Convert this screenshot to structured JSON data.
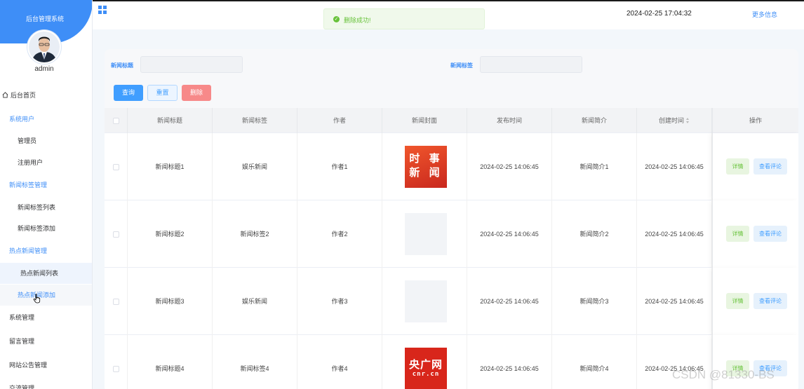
{
  "sidebar": {
    "title": "后台管理系统",
    "username": "admin",
    "menu": {
      "home": "后台首页",
      "system_users": "系统用户",
      "admins": "管理员",
      "registered_users": "注册用户",
      "tag_mgmt": "新闻标签管理",
      "tag_list": "新闻标签列表",
      "tag_add": "新闻标签添加",
      "hot_mgmt": "热点新闻管理",
      "hot_list": "热点新闻列表",
      "hot_add": "热点新闻添加",
      "system_mgmt": "系统管理",
      "message_mgmt": "留言管理",
      "notice_mgmt": "网站公告管理",
      "more": "交流管理"
    }
  },
  "header": {
    "datetime": "2024-02-25 17:04:32",
    "more_info": "更多信息"
  },
  "toast": {
    "message": "删除成功!"
  },
  "search": {
    "title_label": "新闻标题",
    "title_value": "",
    "tag_label": "新闻标签",
    "tag_value": "",
    "query_btn": "查询",
    "reset_btn": "重置",
    "delete_btn": "删除"
  },
  "table": {
    "headers": {
      "title": "新闻标题",
      "tag": "新闻标签",
      "author": "作者",
      "cover": "新闻封面",
      "publish_time": "发布时间",
      "summary": "新闻简介",
      "created": "创建时间",
      "actions": "操作"
    },
    "detail_btn": "详情",
    "comment_btn": "查看评论",
    "rows": [
      {
        "title": "新闻标题1",
        "tag": "娱乐新闻",
        "author": "作者1",
        "cover_text": "时 事\n新 闻",
        "publish_time": "2024-02-25 14:06:45",
        "summary": "新闻简介1",
        "created": "2024-02-25 14:06:45"
      },
      {
        "title": "新闻标题2",
        "tag": "新闻标签2",
        "author": "作者2",
        "publish_time": "2024-02-25 14:06:45",
        "summary": "新闻简介2",
        "created": "2024-02-25 14:06:45"
      },
      {
        "title": "新闻标题3",
        "tag": "娱乐新闻",
        "author": "作者3",
        "publish_time": "2024-02-25 14:06:45",
        "summary": "新闻简介3",
        "created": "2024-02-25 14:06:45"
      },
      {
        "title": "新闻标题4",
        "tag": "新闻标签4",
        "author": "作者4",
        "cover_main": "央广网",
        "cover_sub": "cnr.cn",
        "publish_time": "2024-02-25 14:06:45",
        "summary": "新闻简介4",
        "created": "2024-02-25 14:06:45"
      }
    ]
  },
  "watermark": "CSDN @81330-BS",
  "colors": {
    "primary": "#409eff",
    "sidebar_head": "#3e8ef7",
    "success": "#67c23a",
    "danger": "#f78989"
  }
}
